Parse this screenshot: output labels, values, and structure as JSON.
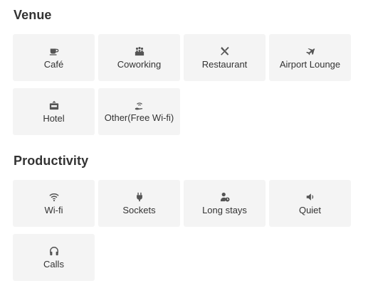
{
  "venue": {
    "title": "Venue",
    "items": [
      {
        "label": "Café",
        "icon": "coffee-cup-icon"
      },
      {
        "label": "Coworking",
        "icon": "coworking-people-icon"
      },
      {
        "label": "Restaurant",
        "icon": "fork-knife-icon"
      },
      {
        "label": "Airport Lounge",
        "icon": "airplane-icon"
      },
      {
        "label": "Hotel",
        "icon": "hotel-sign-icon"
      },
      {
        "label": "Other(Free Wi-fi)",
        "icon": "hand-wifi-icon"
      }
    ]
  },
  "productivity": {
    "title": "Productivity",
    "items": [
      {
        "label": "Wi-fi",
        "icon": "wifi-icon"
      },
      {
        "label": "Sockets",
        "icon": "plug-icon"
      },
      {
        "label": "Long stays",
        "icon": "user-clock-icon"
      },
      {
        "label": "Quiet",
        "icon": "volume-low-icon"
      },
      {
        "label": "Calls",
        "icon": "headphones-icon"
      }
    ]
  },
  "colors": {
    "tile_bg": "#f4f4f4",
    "text": "#333333",
    "icon": "#555555"
  }
}
